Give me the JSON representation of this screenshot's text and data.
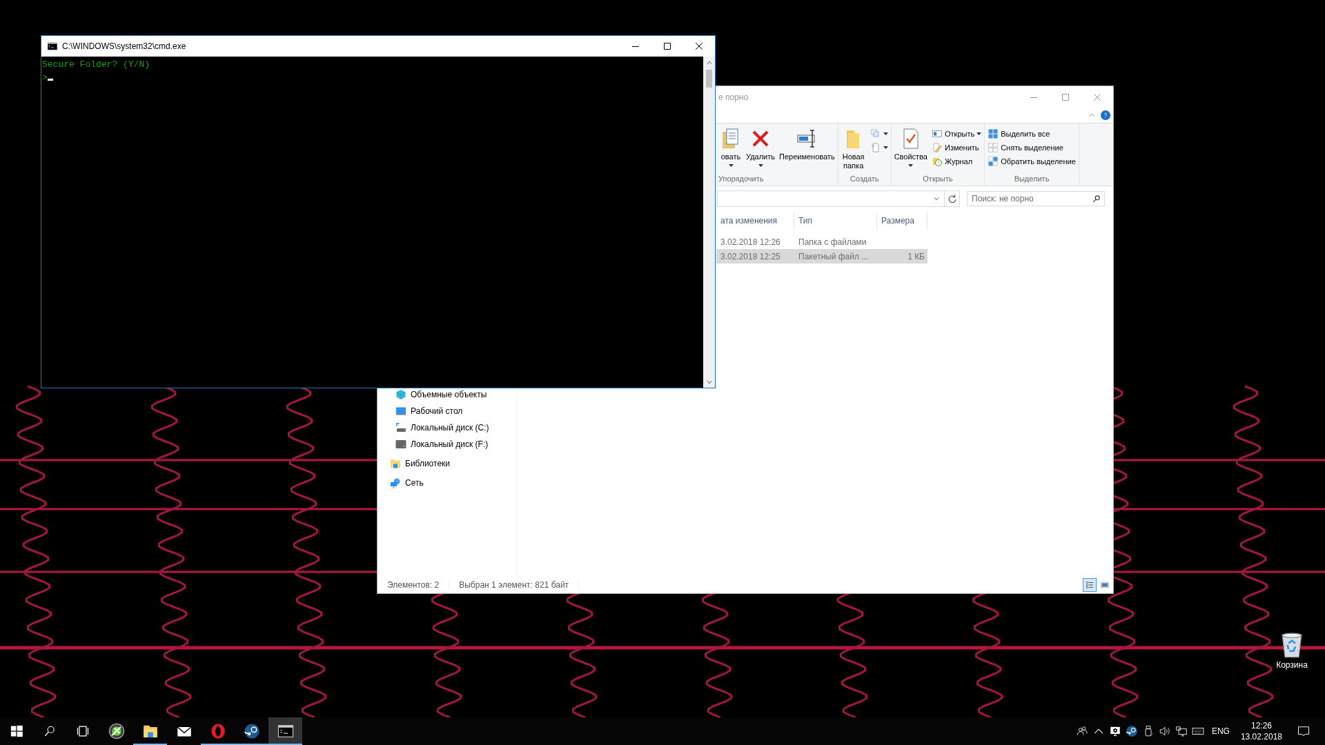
{
  "desktop": {
    "icons": [
      {
        "label": "Корзина",
        "kind": "recycle-bin"
      }
    ]
  },
  "cmd_window": {
    "title": "C:\\WINDOWS\\system32\\cmd.exe",
    "lines": [
      "Secure Folder? (Y/N)",
      ">"
    ]
  },
  "explorer": {
    "title": "е порно",
    "ribbon": [
      {
        "label": "Упорядочить",
        "large": [
          {
            "label": "овать",
            "kind": "paste",
            "dropdown": true
          },
          {
            "label": "Удалить",
            "kind": "delete",
            "dropdown": true
          },
          {
            "label": "Переименовать",
            "kind": "rename",
            "dropdown": false
          }
        ]
      },
      {
        "label": "Создать",
        "large": [
          {
            "label": "Новая папка",
            "kind": "new-folder",
            "dropdown": false
          }
        ],
        "small": [
          {
            "kind": "new-item",
            "dropdown": true
          },
          {
            "kind": "easy-access",
            "dropdown": true
          }
        ]
      },
      {
        "label": "Открыть",
        "large": [
          {
            "label": "Свойства",
            "kind": "properties",
            "dropdown": true
          }
        ],
        "small": [
          {
            "label": "Открыть",
            "kind": "open",
            "dropdown": true
          },
          {
            "label": "Изменить",
            "kind": "edit",
            "dropdown": false
          },
          {
            "label": "Журнал",
            "kind": "history",
            "dropdown": false
          }
        ]
      },
      {
        "label": "Выделить",
        "small": [
          {
            "label": "Выделить все",
            "kind": "select-all",
            "dropdown": false
          },
          {
            "label": "Снять выделение",
            "kind": "select-none",
            "dropdown": false
          },
          {
            "label": "Обратить выделение",
            "kind": "invert-selection",
            "dropdown": false
          }
        ]
      }
    ],
    "search": {
      "placeholder": "Поиск: не порно"
    },
    "columns": [
      "ата изменения",
      "Тип",
      "Размера"
    ],
    "rows": [
      {
        "modified": "3.02.2018 12:26",
        "type": "Папка с файлами",
        "selected": false
      },
      {
        "modified": "3.02.2018 12:25",
        "type": "Пакетный файл ...",
        "size": "1 КБ",
        "selected": true
      }
    ],
    "nav_pane": [
      {
        "children": [
          {
            "label": "Объемные объекты",
            "kind": "objects"
          },
          {
            "label": "Рабочий стол",
            "kind": "desktop"
          },
          {
            "label": "Локальный диск (C:)",
            "kind": "system-drive"
          },
          {
            "label": "Локальный диск (F:)",
            "kind": "drive"
          }
        ]
      },
      {
        "label": "Библиотеки",
        "kind": "libraries"
      },
      {
        "label": "Сеть",
        "kind": "network"
      }
    ],
    "status_bar": [
      "Элементов: 2",
      "Выбран 1 элемент: 821 байт"
    ],
    "views": [
      {
        "kind": "details",
        "selected": true
      },
      {
        "kind": "thumbnails",
        "selected": false
      }
    ]
  },
  "taskbar": {
    "buttons": [
      {
        "kind": "start"
      },
      {
        "kind": "search"
      },
      {
        "kind": "task-view"
      }
    ],
    "apps": [
      {
        "kind": "game",
        "running": false,
        "selected": false
      },
      {
        "kind": "explorer",
        "running": true,
        "selected": false
      },
      {
        "kind": "mail",
        "running": false,
        "selected": false
      },
      {
        "kind": "opera",
        "running": true,
        "selected": false
      },
      {
        "kind": "steam",
        "running": true,
        "selected": false
      },
      {
        "kind": "cmd",
        "running": true,
        "selected": true
      }
    ],
    "tray": [
      {
        "kind": "people"
      },
      {
        "kind": "chevron"
      },
      {
        "kind": "display"
      },
      {
        "kind": "steam"
      },
      {
        "kind": "usb"
      },
      {
        "kind": "volume"
      },
      {
        "kind": "network"
      },
      {
        "kind": "keyboard"
      }
    ],
    "language": "ENG",
    "time": "12:26",
    "date": "13.02.2018"
  }
}
